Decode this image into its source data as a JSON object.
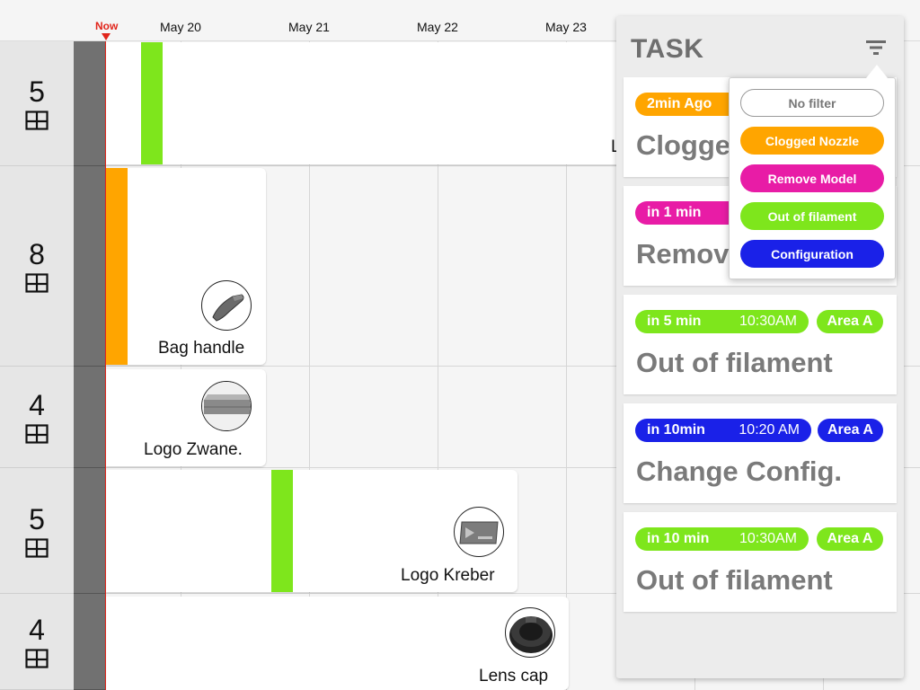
{
  "timeline": {
    "now_label": "Now",
    "dates": [
      "May 20",
      "May 21",
      "May 22",
      "May 23"
    ]
  },
  "rows": [
    {
      "count": "5"
    },
    {
      "count": "8"
    },
    {
      "count": "4"
    },
    {
      "count": "5"
    },
    {
      "count": "4"
    }
  ],
  "jobs": [
    {
      "title": "L",
      "thumb_icon": "none"
    },
    {
      "title": "Bag handle",
      "thumb_icon": "bag-handle-model-icon"
    },
    {
      "title": "Logo Zwane.",
      "thumb_icon": "logo-plate-model-icon"
    },
    {
      "title": "Logo Kreber",
      "thumb_icon": "logo-card-model-icon"
    },
    {
      "title": "Lens cap",
      "thumb_icon": "lens-cap-model-icon"
    }
  ],
  "task_panel": {
    "title": "TASK",
    "filter_icon": "filter-icon",
    "tasks": [
      {
        "time": "2min Ago",
        "clock": "",
        "area": "",
        "name": "Clogged Nozzle",
        "visible_name": "Clogge",
        "color": "#ffa500"
      },
      {
        "time": "in 1 min",
        "clock": "",
        "area": "",
        "name": "Remove Model",
        "visible_name": "Remov",
        "color": "#e81ca6"
      },
      {
        "time": "in 5 min",
        "clock": "10:30AM",
        "area": "Area A",
        "name": "Out of filament",
        "color": "#7ee61c"
      },
      {
        "time": "in 10min",
        "clock": "10:20 AM",
        "area": "Area A",
        "name": "Change Config.",
        "color": "#1a21e8"
      },
      {
        "time": "in 10 min",
        "clock": "10:30AM",
        "area": "Area A",
        "name": "Out of filament",
        "color": "#7ee61c"
      }
    ]
  },
  "filter_menu": {
    "options": [
      {
        "label": "No filter",
        "color": "#ffffff"
      },
      {
        "label": "Clogged Nozzle",
        "color": "#ffa500"
      },
      {
        "label": "Remove Model",
        "color": "#e81ca6"
      },
      {
        "label": "Out of filament",
        "color": "#7ee61c"
      },
      {
        "label": "Configuration",
        "color": "#1a21e8"
      }
    ]
  },
  "colors": {
    "now": "#e1251b",
    "orange": "#ffa500",
    "magenta": "#e81ca6",
    "green": "#7ee61c",
    "blue": "#1a21e8",
    "task_text": "#7a7a7a"
  }
}
